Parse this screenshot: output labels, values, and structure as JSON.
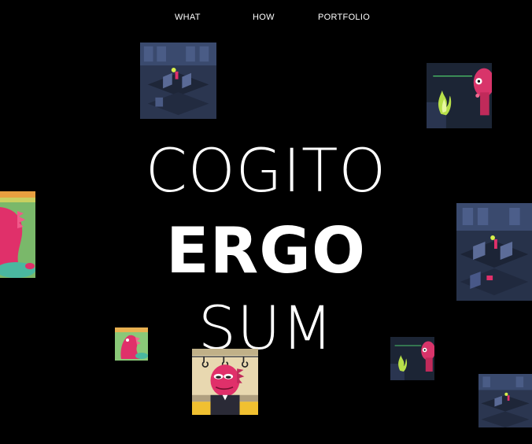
{
  "nav": {
    "items": [
      {
        "label": "WHAT"
      },
      {
        "label": "HOW"
      },
      {
        "label": "PORTFOLIO"
      }
    ]
  },
  "hero": {
    "line1": "COGITO",
    "line2": "ERGO",
    "line3": "SUM"
  },
  "thumbnails": [
    {
      "name": "office-scene"
    },
    {
      "name": "monster-green-flame"
    },
    {
      "name": "pink-monster-crop"
    },
    {
      "name": "office-scene"
    },
    {
      "name": "pink-dinosaur"
    },
    {
      "name": "monster-on-subway"
    },
    {
      "name": "monster-green-flame"
    },
    {
      "name": "office-scene"
    }
  ],
  "colors": {
    "background": "#000000",
    "text": "#ffffff",
    "monster_pink": "#e0306a",
    "flame_green": "#b8e04a",
    "office_blue": "#3a4a6e"
  }
}
